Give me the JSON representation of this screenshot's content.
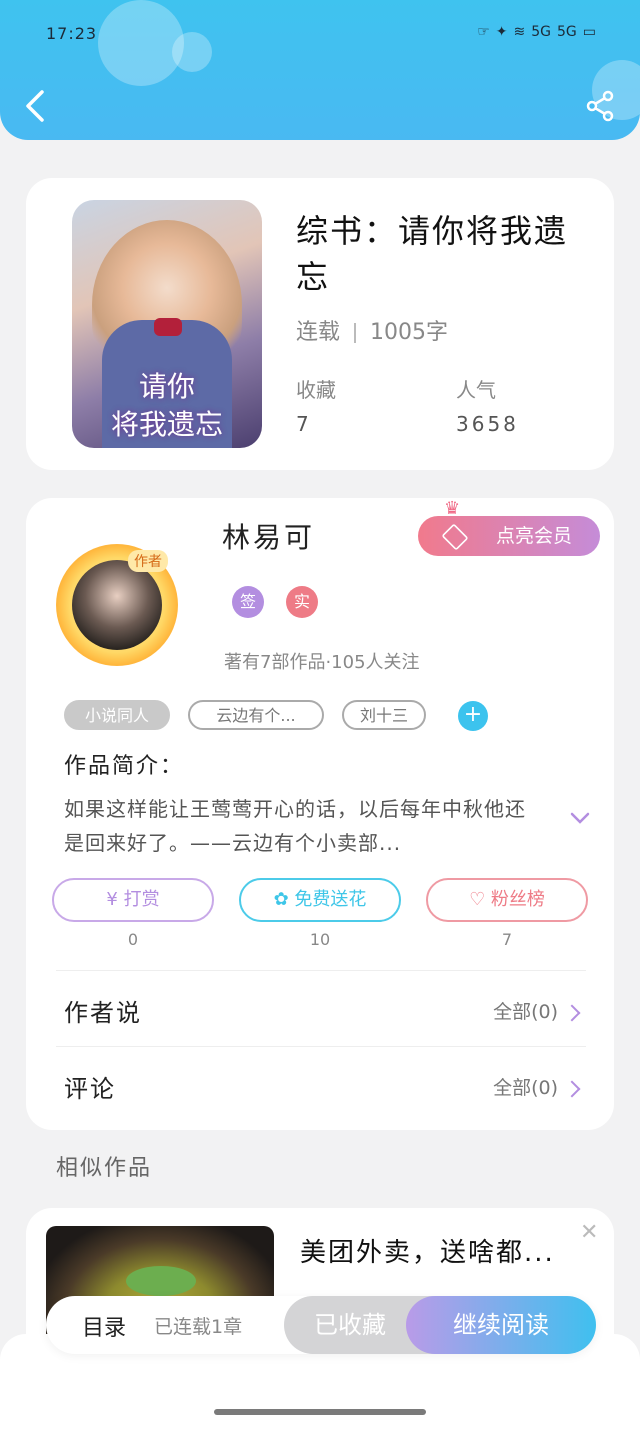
{
  "status_bar": {
    "time": "17:23",
    "icons": [
      "hand-icon",
      "signal-icon",
      "wifi-icon",
      "5G",
      "5G",
      "battery-icon"
    ]
  },
  "book": {
    "cover_title": "请你\n将我遗忘",
    "title": "综书：请你将我遗忘",
    "status": "连载",
    "word_count": "1005字",
    "favorites_label": "收藏",
    "favorites_value": "7",
    "popularity_label": "人气",
    "popularity_value": "3658"
  },
  "author": {
    "avatar_tag": "作者",
    "name": "林易可",
    "vip_button": "点亮会员",
    "badges": [
      "签",
      "实"
    ],
    "works_summary": "著有7部作品·105人关注"
  },
  "tags": [
    "小说同人",
    "云边有个...",
    "刘十三"
  ],
  "intro": {
    "label": "作品简介：",
    "text": "如果这样能让王莺莺开心的话，以后每年中秋他还是回来好了。——云边有个小卖部..."
  },
  "actions": [
    {
      "label": "打赏",
      "count": "0",
      "color": "#b38ee0"
    },
    {
      "label": "免费送花",
      "count": "10",
      "color": "#3ec6e8"
    },
    {
      "label": "粉丝榜",
      "count": "7",
      "color": "#ee7b86"
    }
  ],
  "rows": [
    {
      "label": "作者说",
      "right": "全部(0)"
    },
    {
      "label": "评论",
      "right": "全部(0)"
    }
  ],
  "similar": {
    "section_title": "相似作品",
    "item_title": "美团外卖，送啥都..."
  },
  "bottom_bar": {
    "toc_label": "目录",
    "toc_count": "已连载1章",
    "collected_label": "已收藏",
    "read_label": "继续阅读"
  }
}
